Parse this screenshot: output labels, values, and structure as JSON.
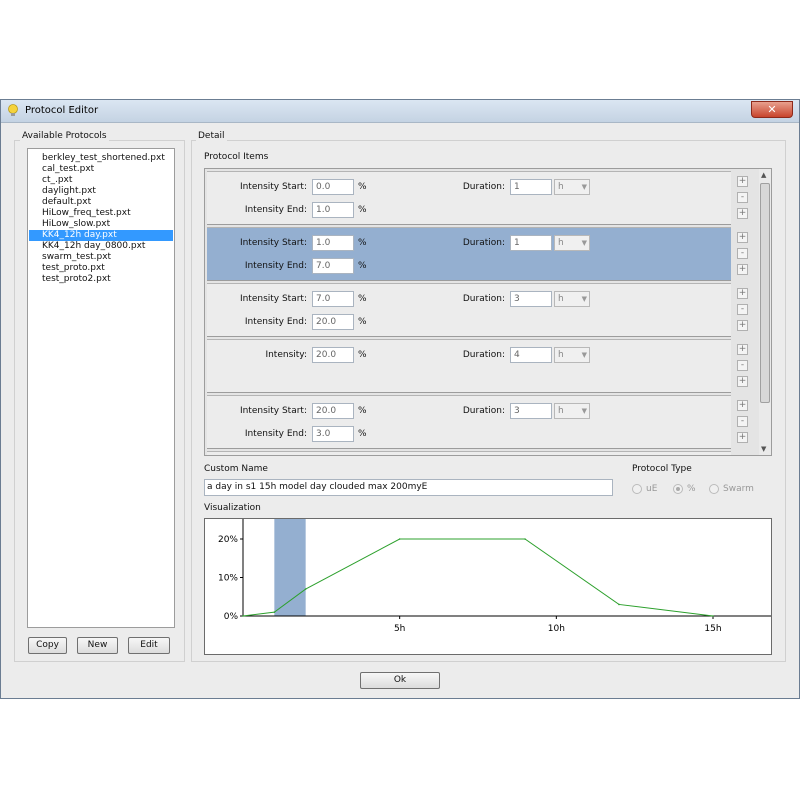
{
  "window": {
    "title": "Protocol Editor",
    "close_glyph": "✕"
  },
  "protocols": {
    "label": "Available Protocols",
    "items": [
      "berkley_test_shortened.pxt",
      "cal_test.pxt",
      "ct_.pxt",
      "daylight.pxt",
      "default.pxt",
      "HiLow_freq_test.pxt",
      "HiLow_slow.pxt",
      "KK4_12h day.pxt",
      "KK4_12h day_0800.pxt",
      "swarm_test.pxt",
      "test_proto.pxt",
      "test_proto2.pxt"
    ],
    "selected_index": 7,
    "buttons": {
      "copy": "Copy",
      "new": "New",
      "edit": "Edit"
    }
  },
  "detail": {
    "label": "Detail",
    "items_label": "Protocol Items",
    "items": [
      {
        "type": "ramp",
        "start_label": "Intensity Start:",
        "start": "0.0",
        "end_label": "Intensity End:",
        "end": "1.0",
        "unit": "%",
        "duration_label": "Duration:",
        "duration": "1",
        "duration_unit": "h",
        "selected": false
      },
      {
        "type": "ramp",
        "start_label": "Intensity Start:",
        "start": "1.0",
        "end_label": "Intensity End:",
        "end": "7.0",
        "unit": "%",
        "duration_label": "Duration:",
        "duration": "1",
        "duration_unit": "h",
        "selected": true
      },
      {
        "type": "ramp",
        "start_label": "Intensity Start:",
        "start": "7.0",
        "end_label": "Intensity End:",
        "end": "20.0",
        "unit": "%",
        "duration_label": "Duration:",
        "duration": "3",
        "duration_unit": "h",
        "selected": false
      },
      {
        "type": "constant",
        "start_label": "Intensity:",
        "start": "20.0",
        "unit": "%",
        "duration_label": "Duration:",
        "duration": "4",
        "duration_unit": "h",
        "selected": false
      },
      {
        "type": "ramp",
        "start_label": "Intensity Start:",
        "start": "20.0",
        "end_label": "Intensity End:",
        "end": "3.0",
        "unit": "%",
        "duration_label": "Duration:",
        "duration": "3",
        "duration_unit": "h",
        "selected": false
      }
    ],
    "step_buttons": [
      "+",
      "-",
      "+"
    ],
    "custom_name_label": "Custom Name",
    "custom_name": "a day in s1 15h model day clouded max 200myE",
    "protocol_type_label": "Protocol Type",
    "protocol_types": [
      "uE",
      "%",
      "Swarm"
    ],
    "protocol_type_selected": 1,
    "visualization_label": "Visualization"
  },
  "chart_data": {
    "type": "line",
    "x": [
      0,
      1,
      2,
      5,
      9,
      12,
      15
    ],
    "y": [
      0,
      1,
      7,
      20,
      20,
      3,
      0
    ],
    "x_ticks": [
      "5h",
      "10h",
      "15h"
    ],
    "x_tick_values": [
      5,
      10,
      15
    ],
    "y_ticks": [
      "0%",
      "10%",
      "20%"
    ],
    "y_tick_values": [
      0,
      10,
      20
    ],
    "xlim": [
      0,
      16
    ],
    "ylim": [
      0,
      22
    ],
    "highlight_range": [
      1,
      2
    ],
    "line_color": "#2ca02c",
    "highlight_color": "#94afd0",
    "grid": false
  },
  "ok_button": "Ok",
  "colors": {
    "selection": "#3399ff",
    "item_selected": "#94afd0"
  }
}
